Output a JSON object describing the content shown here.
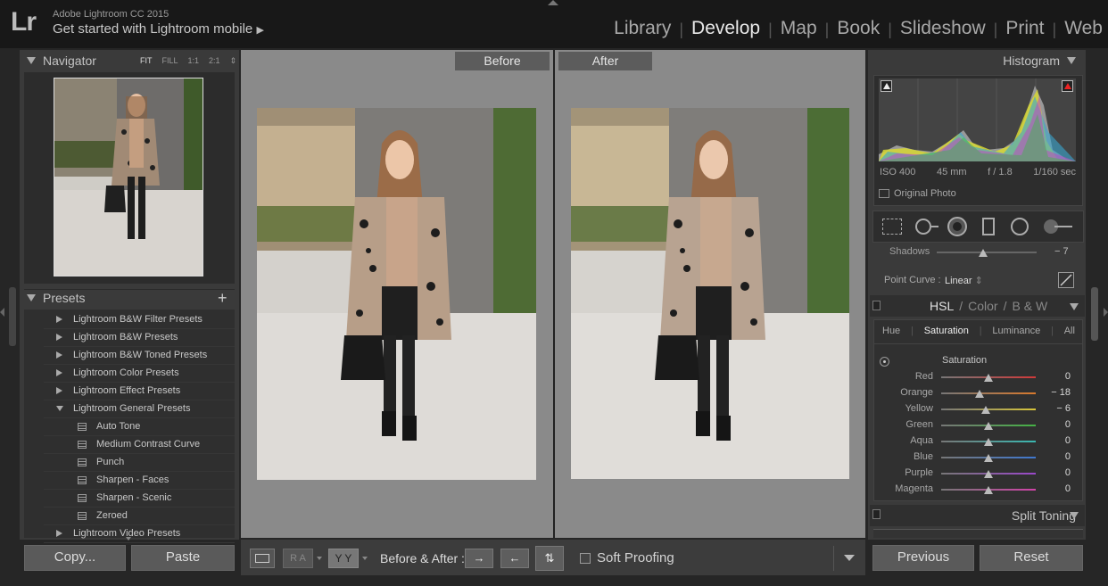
{
  "app": {
    "logo": "Lr",
    "name": "Adobe Lightroom CC 2015",
    "mobile_label": "Get started with Lightroom mobile"
  },
  "modules": [
    "Library",
    "Develop",
    "Map",
    "Book",
    "Slideshow",
    "Print",
    "Web"
  ],
  "active_module": "Develop",
  "navigator": {
    "title": "Navigator",
    "zoom_options": [
      "FIT",
      "FILL",
      "1:1",
      "2:1"
    ]
  },
  "presets": {
    "title": "Presets",
    "add": "+",
    "folders": [
      "Lightroom B&W Filter Presets",
      "Lightroom B&W Presets",
      "Lightroom B&W Toned Presets",
      "Lightroom Color Presets",
      "Lightroom Effect Presets",
      "Lightroom General Presets"
    ],
    "general_items": [
      "Auto Tone",
      "Medium Contrast Curve",
      "Punch",
      "Sharpen - Faces",
      "Sharpen - Scenic",
      "Zeroed"
    ],
    "last_folder": "Lightroom Video Presets"
  },
  "left_buttons": {
    "copy": "Copy...",
    "paste": "Paste"
  },
  "view": {
    "before": "Before",
    "after": "After"
  },
  "toolbar": {
    "ba_label": "Before & After :",
    "ra": "R A",
    "yy": "Y Y",
    "soft_proofing": "Soft Proofing"
  },
  "histogram": {
    "title": "Histogram",
    "iso": "ISO 400",
    "focal": "45 mm",
    "aperture": "f / 1.8",
    "shutter": "1/160 sec",
    "original": "Original Photo"
  },
  "tone": {
    "shadows_label": "Shadows",
    "shadows_value": "− 7",
    "point_curve_label": "Point Curve :",
    "point_curve_value": "Linear"
  },
  "hsl": {
    "header": [
      "HSL",
      "Color",
      "B & W"
    ],
    "tabs": [
      "Hue",
      "Saturation",
      "Luminance",
      "All"
    ],
    "active_tab": "Saturation",
    "section": "Saturation",
    "rows": [
      {
        "label": "Red",
        "value": "0",
        "amount": 0,
        "color": "#d03a3a"
      },
      {
        "label": "Orange",
        "value": "− 18",
        "amount": -18,
        "color": "#d8792d"
      },
      {
        "label": "Yellow",
        "value": "− 6",
        "amount": -6,
        "color": "#d7c53a"
      },
      {
        "label": "Green",
        "value": "0",
        "amount": 0,
        "color": "#45b145"
      },
      {
        "label": "Aqua",
        "value": "0",
        "amount": 0,
        "color": "#3ab7b0"
      },
      {
        "label": "Blue",
        "value": "0",
        "amount": 0,
        "color": "#3f78cf"
      },
      {
        "label": "Purple",
        "value": "0",
        "amount": 0,
        "color": "#9a48c9"
      },
      {
        "label": "Magenta",
        "value": "0",
        "amount": 0,
        "color": "#d043a8"
      }
    ]
  },
  "split_toning": {
    "title": "Split Toning"
  },
  "right_buttons": {
    "previous": "Previous",
    "reset": "Reset"
  }
}
